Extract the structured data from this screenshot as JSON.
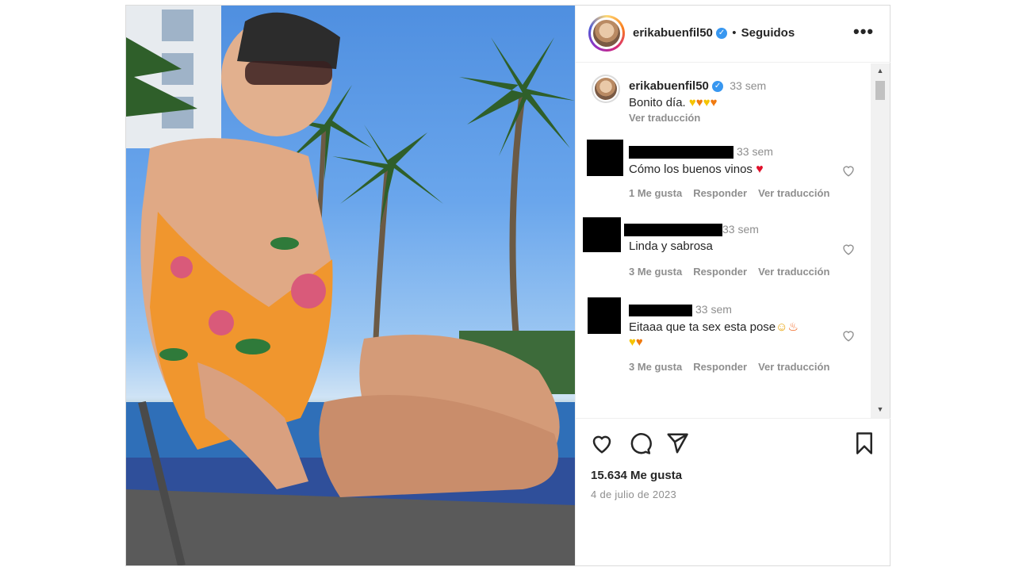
{
  "post": {
    "username": "erikabuenfil50",
    "verified_icon": "verified-check-icon",
    "follow_separator": "•",
    "follow_status": "Seguidos",
    "more_icon": "more-horizontal-icon"
  },
  "caption": {
    "username": "erikabuenfil50",
    "time": "33 sem",
    "text": "Bonito día.",
    "emojis": [
      "yellow-heart",
      "orange-heart",
      "yellow-heart",
      "orange-heart"
    ],
    "translate": "Ver traducción"
  },
  "comments": [
    {
      "time": "33 sem",
      "text": "Cómo los buenos vinos",
      "emoji": "red-heart",
      "likes": "1 Me gusta",
      "reply": "Responder",
      "translate": "Ver traducción"
    },
    {
      "time": "33 sem",
      "text": "Linda y sabrosa",
      "likes": "3 Me gusta",
      "reply": "Responder",
      "translate": "Ver traducción"
    },
    {
      "time": "33 sem",
      "text": "Eitaaa que ta sex esta pose",
      "emojis": [
        "smiling-face",
        "fire",
        "yellow-heart",
        "orange-heart"
      ],
      "likes": "3 Me gusta",
      "reply": "Responder",
      "translate": "Ver traducción"
    }
  ],
  "actions": {
    "like_icon": "heart-icon",
    "comment_icon": "comment-icon",
    "share_icon": "send-icon",
    "save_icon": "bookmark-icon"
  },
  "stats": {
    "likes": "15.634 Me gusta",
    "date": "4 de julio de 2023"
  },
  "colors": {
    "text": "#262626",
    "muted": "#8e8e8e",
    "verified": "#3897f0",
    "border": "#dbdbdb"
  }
}
